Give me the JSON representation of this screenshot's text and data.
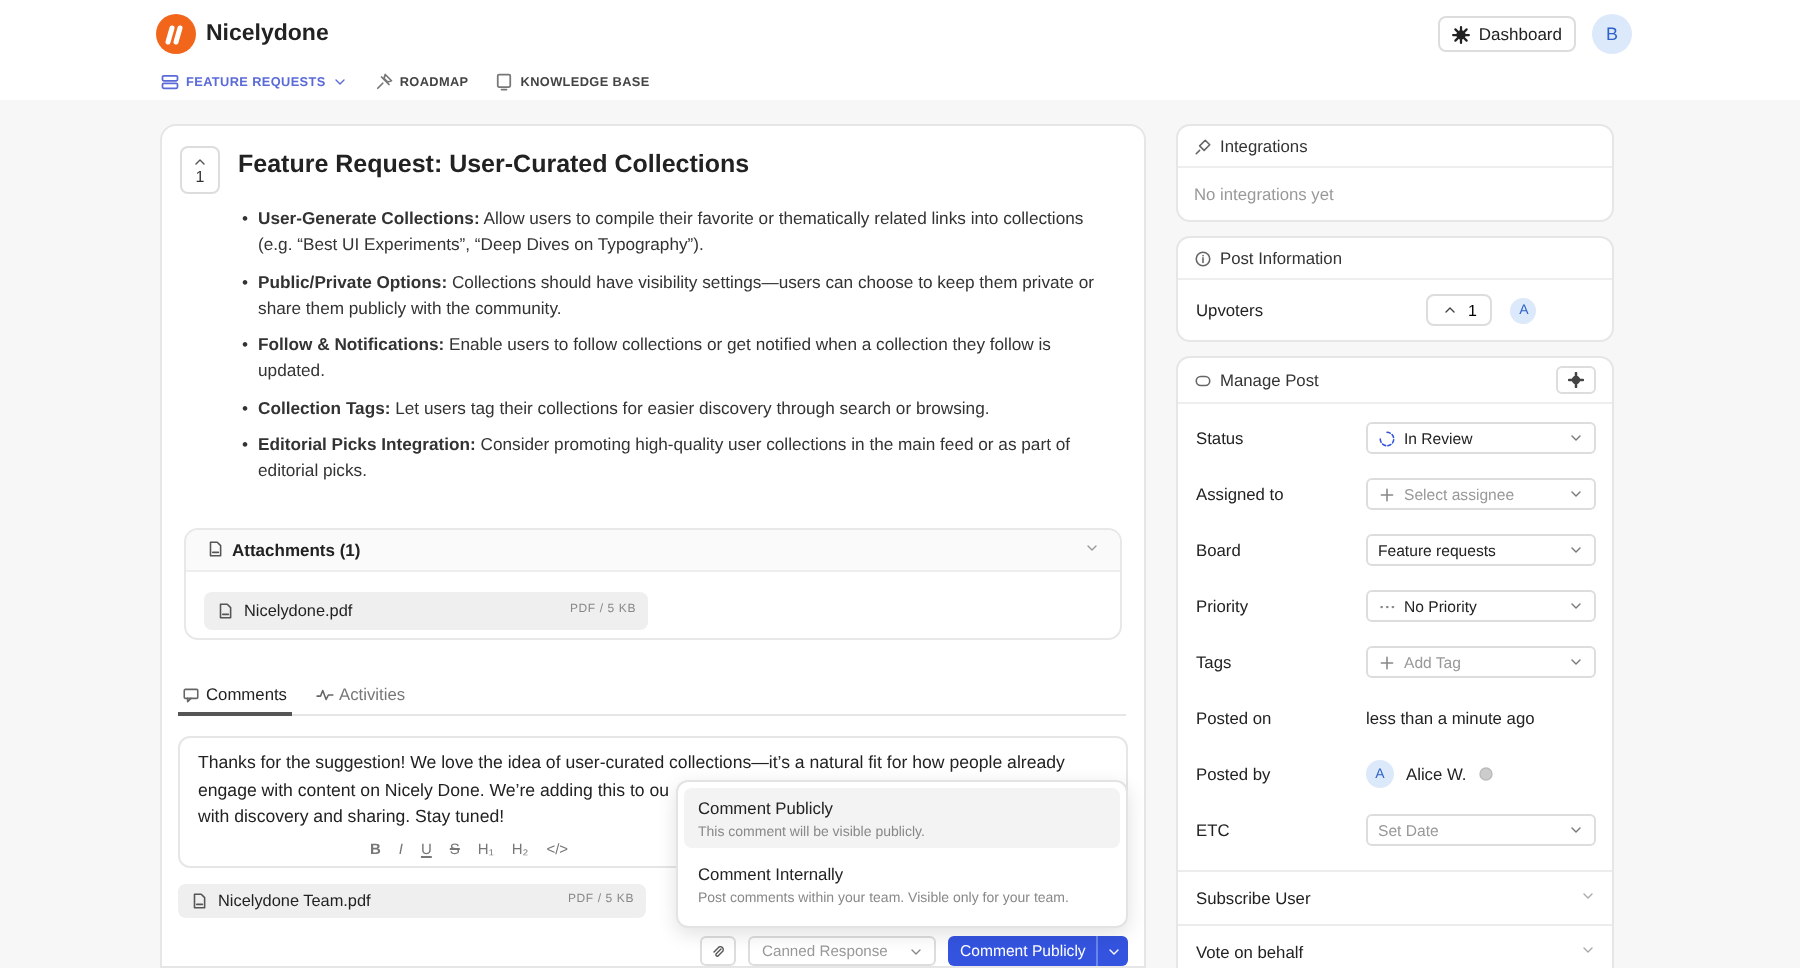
{
  "header": {
    "brand": "Nicelydone",
    "dashboard_button": "Dashboard",
    "avatar": "B"
  },
  "nav": [
    {
      "label": "FEATURE REQUESTS",
      "selected": true,
      "dropdown": true
    },
    {
      "label": "ROADMAP",
      "selected": false,
      "dropdown": false
    },
    {
      "label": "KNOWLEDGE BASE",
      "selected": false,
      "dropdown": false
    }
  ],
  "post": {
    "votes": "1",
    "title": "Feature Request: User-Curated Collections",
    "bullets": [
      {
        "marker": "•",
        "lead": "User-Generate Collections:",
        "text": "Allow users to compile their favorite or thematically related links into collections (e.g. “Best UI Experiments”, “Deep Dives on Typography”)."
      },
      {
        "marker": "•",
        "lead": "Public/Private Options:",
        "text": "Collections should have visibility settings—users can choose to keep them private or share them publicly with the community."
      },
      {
        "marker": "•",
        "lead": "Follow & Notifications:",
        "text": "Enable users to follow collections or get notified when a collection they follow is updated."
      },
      {
        "marker": "•",
        "lead": "Collection Tags:",
        "text": "Let users tag their collections for easier discovery through search or browsing."
      },
      {
        "marker": "•",
        "lead": "Editorial Picks Integration:",
        "text": "Consider promoting high-quality user collections in the main feed or as part of editorial picks."
      }
    ],
    "attachments": {
      "title": "Attachments (1)",
      "expanded": true,
      "files": [
        {
          "name": "Nicelydone.pdf",
          "meta": "PDF / 5 KB"
        }
      ]
    }
  },
  "comment_tabs": [
    {
      "label": "Comments",
      "selected": true
    },
    {
      "label": "Activities",
      "selected": false
    }
  ],
  "editor": {
    "lines": [
      "Thanks for the suggestion! We love the idea of user-curated collections—it’s a natural fit for how people already",
      "engage with content on Nicely Done. We’re adding this to ou",
      "with discovery and sharing. Stay tuned!"
    ],
    "toolbar": [
      {
        "label": "B",
        "kind": "bold"
      },
      {
        "label": "I",
        "kind": "italic"
      },
      {
        "label": "U",
        "kind": "underline"
      },
      {
        "label": "S",
        "kind": "strike"
      },
      {
        "label": "H₁",
        "kind": "plain"
      },
      {
        "label": "H₂",
        "kind": "plain"
      },
      {
        "label": "</>",
        "kind": "plain"
      }
    ]
  },
  "comment_file": {
    "name": "Nicelydone Team.pdf",
    "meta": "PDF / 5 KB"
  },
  "comment_menu": [
    {
      "title": "Comment Publicly",
      "description": "This comment will be visible publicly.",
      "selected": true
    },
    {
      "title": "Comment Internally",
      "description": "Post comments within your team. Visible only for your team.",
      "selected": false
    }
  ],
  "actions": {
    "canned": "Canned Response",
    "submit": "Comment Publicly"
  },
  "integrations": {
    "title": "Integrations",
    "empty": "No integrations yet"
  },
  "post_info": {
    "title": "Post Information",
    "label": "Upvoters",
    "count": "1",
    "avatar": "A"
  },
  "manage": {
    "title": "Manage Post",
    "rows": [
      {
        "kind": "status",
        "label": "Status",
        "value": "In Review"
      },
      {
        "kind": "adder",
        "label": "Assigned to",
        "placeholder": "Select assignee"
      },
      {
        "kind": "select",
        "label": "Board",
        "value": "Feature requests"
      },
      {
        "kind": "priority",
        "label": "Priority",
        "value": "No Priority"
      },
      {
        "kind": "adder",
        "label": "Tags",
        "placeholder": "Add Tag"
      },
      {
        "kind": "text",
        "label": "Posted on",
        "value": "less than a minute ago"
      },
      {
        "kind": "person",
        "label": "Posted by",
        "avatar": "A",
        "value": "Alice W."
      },
      {
        "kind": "select",
        "label": "ETC",
        "placeholder": "Set Date"
      }
    ],
    "sections": [
      {
        "label": "Subscribe User",
        "expanded": false
      },
      {
        "label": "Vote on behalf",
        "expanded": false
      }
    ]
  }
}
